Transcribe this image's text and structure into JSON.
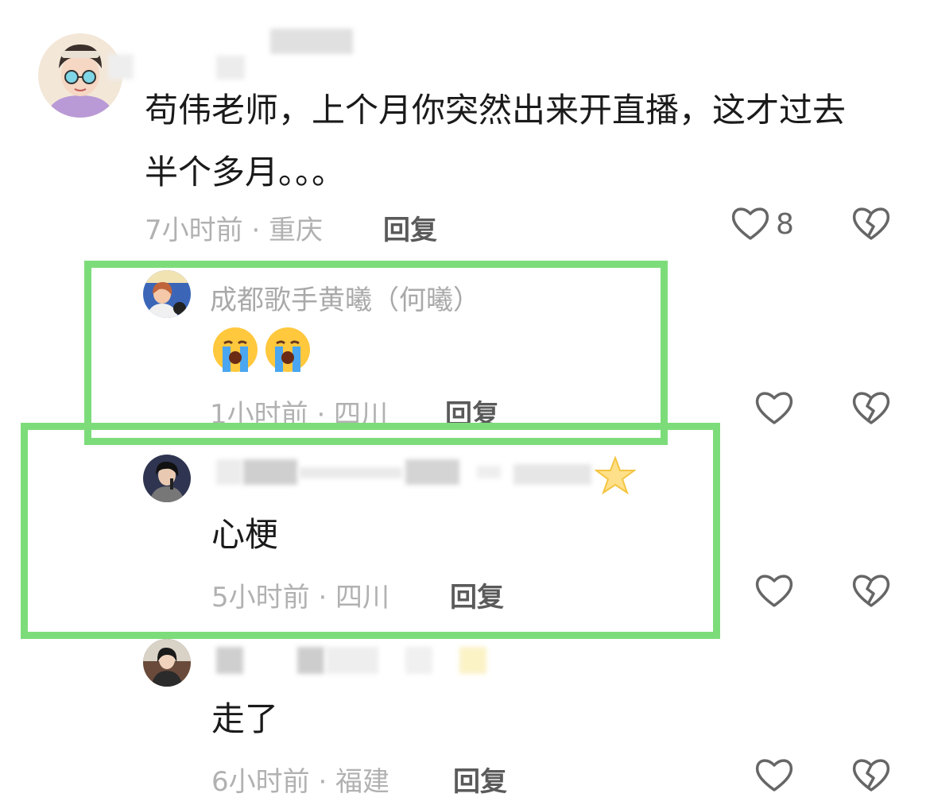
{
  "comments": [
    {
      "text_line1": "苟伟老师，上个月你突然出来开直播，这才过去",
      "text_line2": "半个多月。。。",
      "meta": "7小时前 · 重庆",
      "reply_label": "回复",
      "like_count": "8"
    },
    {
      "username": "成都歌手黄曦（何曦）",
      "meta": "1小时前 · 四川",
      "reply_label": "回复"
    },
    {
      "text": "心梗",
      "meta": "5小时前 · 四川",
      "reply_label": "回复"
    },
    {
      "text": "走了",
      "meta": "6小时前 · 福建",
      "reply_label": "回复"
    }
  ],
  "colors": {
    "highlight": "#7ddc7a",
    "meta_text": "#b1b1b1",
    "reply_text": "#5a5a5a",
    "icon_stroke": "#666666"
  }
}
